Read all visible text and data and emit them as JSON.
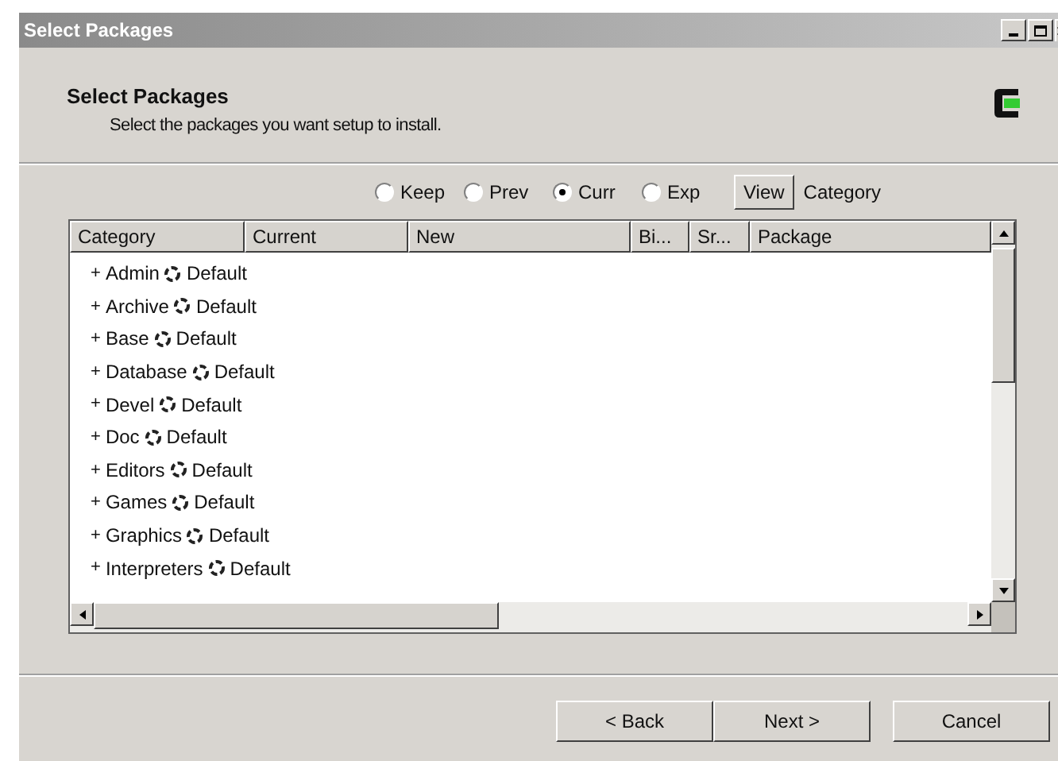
{
  "window": {
    "title": "Select Packages"
  },
  "header": {
    "title": "Select Packages",
    "subtitle": "Select the packages you want setup to install."
  },
  "view_options": [
    {
      "label": "Keep",
      "selected": false
    },
    {
      "label": "Prev",
      "selected": false
    },
    {
      "label": "Curr",
      "selected": true
    },
    {
      "label": "Exp",
      "selected": false
    }
  ],
  "view_button": "View",
  "view_mode": "Category",
  "table": {
    "columns": [
      "Category",
      "Current",
      "New",
      "Bi...",
      "Sr...",
      "Package"
    ],
    "rows": [
      {
        "expander": "+",
        "name": "Admin",
        "action": "Default"
      },
      {
        "expander": "+",
        "name": "Archive",
        "action": "Default"
      },
      {
        "expander": "+",
        "name": "Base",
        "action": "Default"
      },
      {
        "expander": "+",
        "name": "Database",
        "action": "Default"
      },
      {
        "expander": "+",
        "name": "Devel",
        "action": "Default"
      },
      {
        "expander": "+",
        "name": "Doc",
        "action": "Default"
      },
      {
        "expander": "+",
        "name": "Editors",
        "action": "Default"
      },
      {
        "expander": "+",
        "name": "Games",
        "action": "Default"
      },
      {
        "expander": "+",
        "name": "Graphics",
        "action": "Default"
      },
      {
        "expander": "+",
        "name": "Interpreters",
        "action": "Default"
      }
    ]
  },
  "buttons": [
    "< Back",
    "Next >",
    "Cancel"
  ]
}
